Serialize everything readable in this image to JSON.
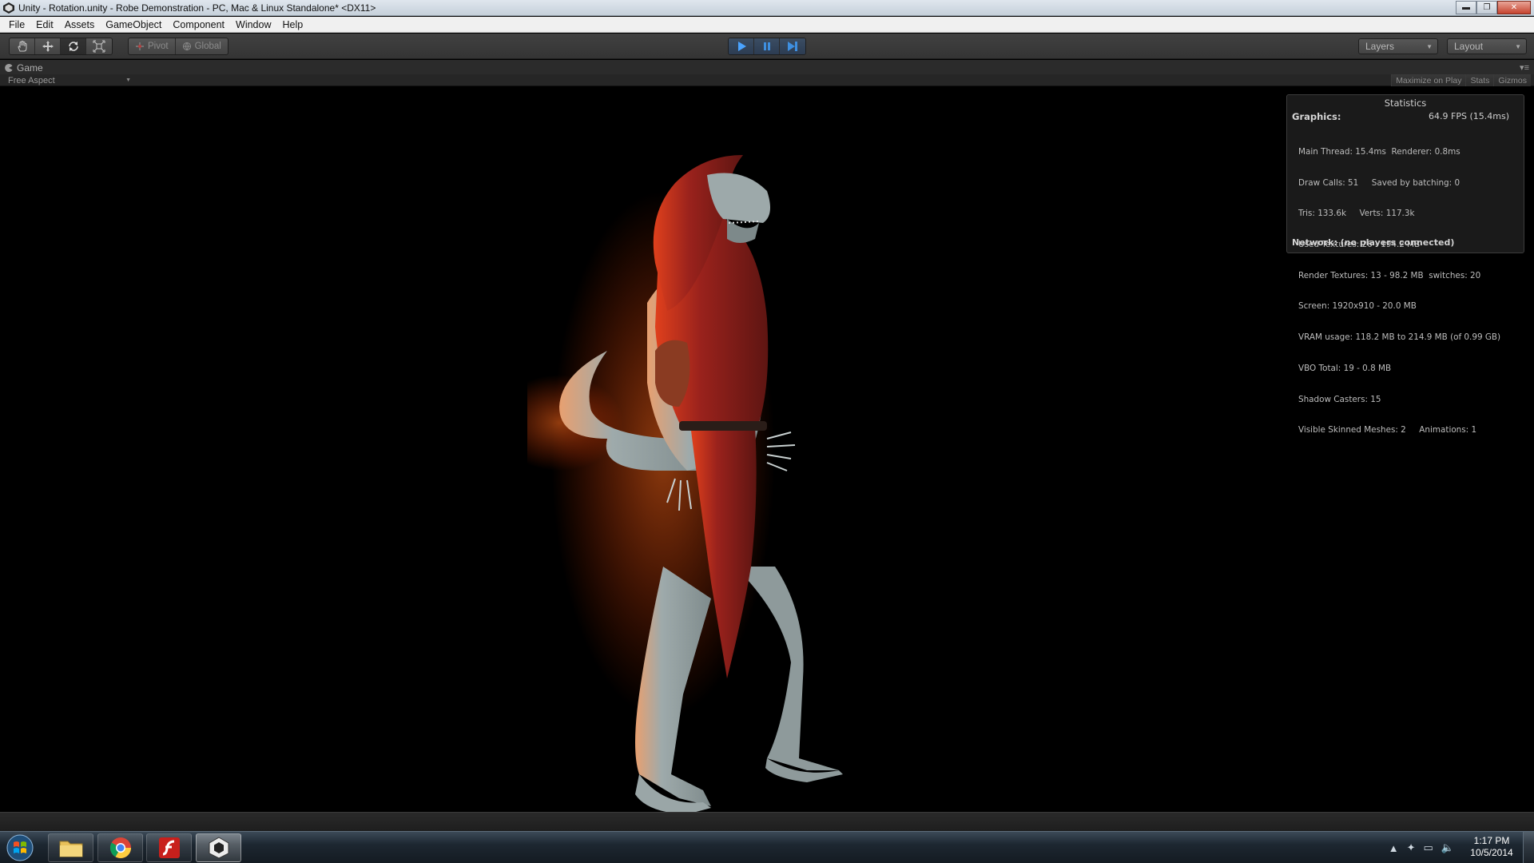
{
  "window": {
    "title": "Unity - Rotation.unity - Robe Demonstration - PC, Mac & Linux Standalone* <DX11>",
    "buttons": {
      "minimize": "▬",
      "maximize": "❐",
      "close": "✕"
    }
  },
  "menu": [
    "File",
    "Edit",
    "Assets",
    "GameObject",
    "Component",
    "Window",
    "Help"
  ],
  "toolbar": {
    "tools": [
      "hand-tool",
      "move-tool",
      "rotate-tool",
      "scale-tool"
    ],
    "active_tool": "rotate-tool",
    "pivot_label": "Pivot",
    "global_label": "Global",
    "play_state": "playing",
    "layers_label": "Layers",
    "layout_label": "Layout"
  },
  "game_view": {
    "tab_label": "Game",
    "aspect": "Free Aspect",
    "right_buttons": [
      "Maximize on Play",
      "Stats",
      "Gizmos"
    ]
  },
  "statistics": {
    "title": "Statistics",
    "graphics_label": "Graphics:",
    "fps": "64.9 FPS (15.4ms)",
    "lines": [
      "Main Thread: 15.4ms  Renderer: 0.8ms",
      "Draw Calls: 51     Saved by batching: 0",
      "Tris: 133.6k     Verts: 117.3k",
      "Used Textures: 26 - 194.2 MB",
      "Render Textures: 13 - 98.2 MB  switches: 20",
      "Screen: 1920x910 - 20.0 MB",
      "VRAM usage: 118.2 MB to 214.9 MB (of 0.99 GB)",
      "VBO Total: 19 - 0.8 MB",
      "Shadow Casters: 15",
      "Visible Skinned Meshes: 2     Animations: 1"
    ],
    "network": "Network: (no players connected)"
  },
  "taskbar": {
    "apps": [
      "explorer",
      "chrome",
      "flash",
      "unity"
    ],
    "active_app": "unity",
    "time": "1:17 PM",
    "date": "10/5/2014"
  },
  "colors": {
    "robe": "#8e1f1a",
    "glow": "#ff5a1a",
    "skin": "#a9b6b6",
    "play_active": "#4aa3ff"
  }
}
